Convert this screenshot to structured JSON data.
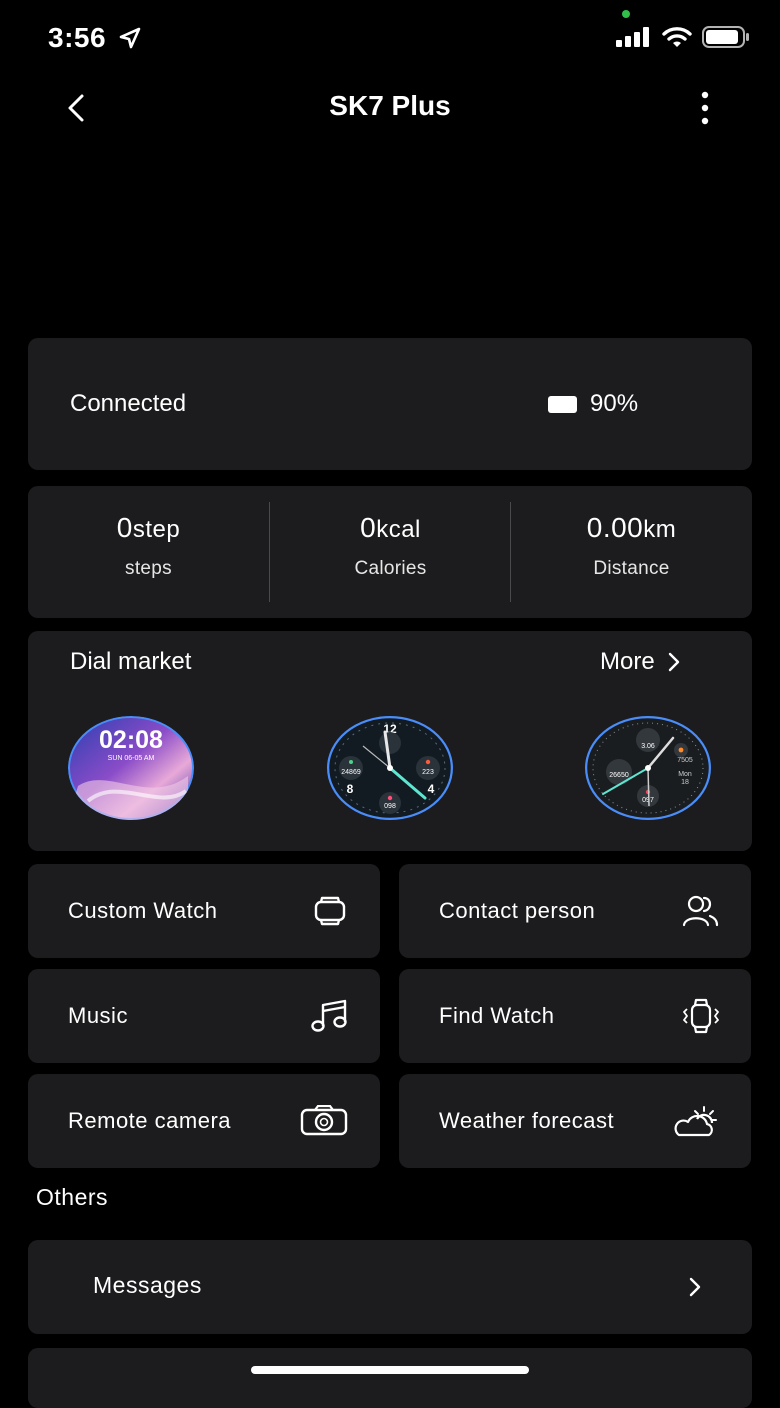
{
  "status_bar": {
    "time": "3:56"
  },
  "nav": {
    "title": "SK7 Plus"
  },
  "connection": {
    "status": "Connected",
    "battery": "90%"
  },
  "stats": [
    {
      "value": "0",
      "unit": "step",
      "label": "steps"
    },
    {
      "value": "0",
      "unit": "kcal",
      "label": "Calories"
    },
    {
      "value": "0.00",
      "unit": "km",
      "label": "Distance"
    }
  ],
  "dial_market": {
    "title": "Dial market",
    "more": "More",
    "dials": [
      {
        "time": "02:08",
        "date": "SUN   06-05   AM"
      },
      {
        "n12": "12",
        "n8": "8",
        "n4": "4",
        "steps": "24869",
        "cal": "223",
        "hr": "098"
      },
      {
        "top": "3.06",
        "steps": "26650",
        "hr": "097",
        "cal": "7505",
        "day": "Mon",
        "date": "18"
      }
    ]
  },
  "tiles": [
    {
      "label": "Custom Watch",
      "icon": "watch-icon"
    },
    {
      "label": "Contact person",
      "icon": "contacts-icon"
    },
    {
      "label": "Music",
      "icon": "music-note-icon"
    },
    {
      "label": "Find Watch",
      "icon": "vibrating-watch-icon"
    },
    {
      "label": "Remote camera",
      "icon": "camera-icon"
    },
    {
      "label": "Weather forecast",
      "icon": "weather-icon"
    }
  ],
  "others": {
    "title": "Others",
    "messages": "Messages"
  },
  "colors": {
    "background": "#000000",
    "card": "#1c1c1e",
    "accent_blue": "#4a8df8"
  }
}
